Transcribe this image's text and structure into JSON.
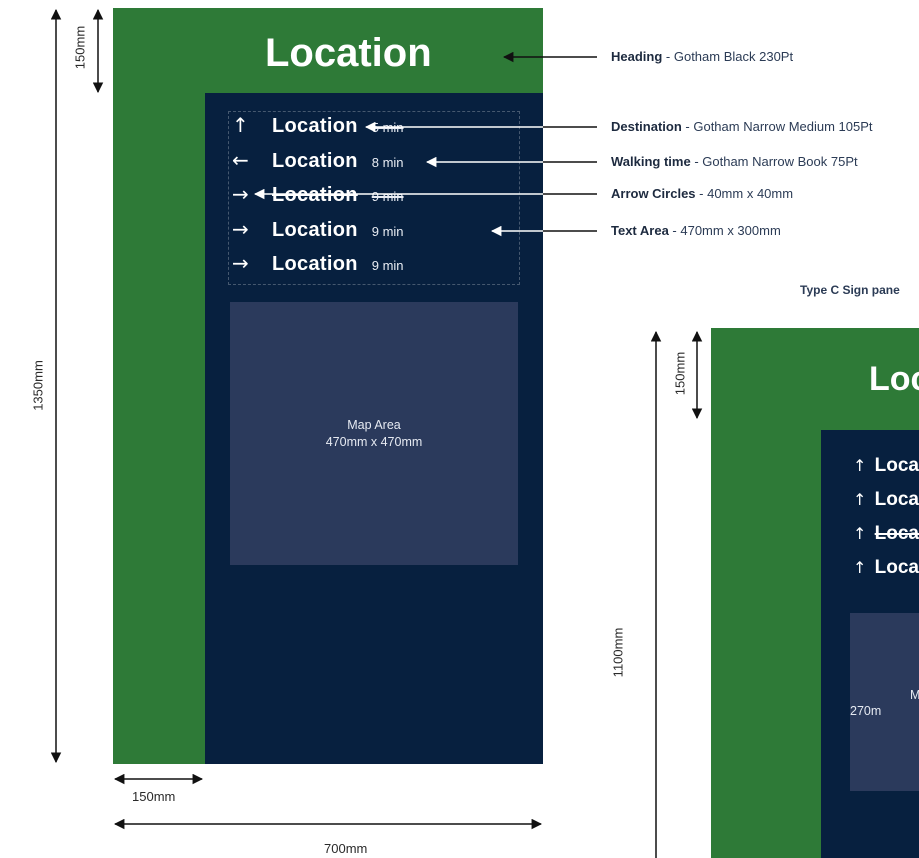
{
  "sign_a": {
    "heading": "Location",
    "rows": [
      {
        "arrow": "↑",
        "location": "Location",
        "time": "5 min"
      },
      {
        "arrow": "←",
        "location": "Location",
        "time": "8 min"
      },
      {
        "arrow": "→",
        "location": "Location",
        "time": "9 min"
      },
      {
        "arrow": "→",
        "location": "Location",
        "time": "9 min"
      },
      {
        "arrow": "→",
        "location": "Location",
        "time": "9 min"
      }
    ],
    "map_title": "Map Area",
    "map_size": "470mm x 470mm"
  },
  "dimensions_a": {
    "height_total": "1350mm",
    "heading_height": "150mm",
    "side_width": "150mm",
    "total_width": "700mm"
  },
  "specs": [
    {
      "label": "Heading",
      "detail": " - Gotham Black 230Pt"
    },
    {
      "label": "Destination",
      "detail": " - Gotham Narrow Medium 105Pt"
    },
    {
      "label": "Walking time",
      "detail": " - Gotham Narrow Book 75Pt"
    },
    {
      "label": "Arrow Circles",
      "detail": " - 40mm x 40mm"
    },
    {
      "label": "Text Area",
      "detail": " - 470mm x 300mm"
    }
  ],
  "sign_c": {
    "caption": "Type C Sign pane",
    "heading": "Loc",
    "rows": [
      {
        "arrow": "↑",
        "location": "Loca"
      },
      {
        "arrow": "↑",
        "location": "Loca"
      },
      {
        "arrow": "↑",
        "location": "Loca"
      },
      {
        "arrow": "↑",
        "location": "Loca"
      }
    ],
    "map_title": "M",
    "map_size": "270m"
  },
  "dimensions_c": {
    "heading_height": "150mm",
    "height_total": "1100mm"
  },
  "colors": {
    "green": "#2e7a37",
    "navy": "#07203f",
    "map": "#2b3a5c"
  }
}
